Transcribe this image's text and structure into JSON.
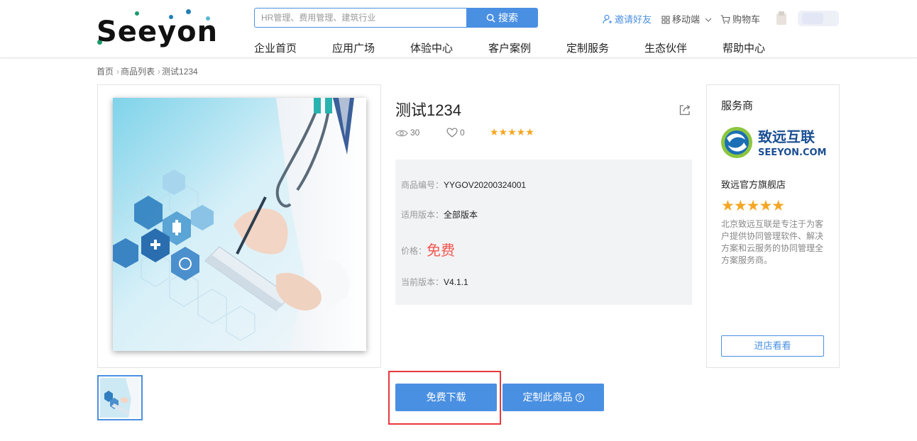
{
  "header": {
    "logo_text": "Seeyon",
    "search_placeholder": "HR管理、费用管理、建筑行业",
    "search_button": "搜索",
    "invite_label": "邀请好友",
    "mobile_label": "移动端",
    "cart_label": "购物车",
    "nav": [
      "企业首页",
      "应用广场",
      "体验中心",
      "客户案例",
      "定制服务",
      "生态伙伴",
      "帮助中心"
    ]
  },
  "breadcrumb": [
    "首页",
    "商品列表",
    "测试1234"
  ],
  "product": {
    "title": "测试1234",
    "views": "30",
    "likes": "0",
    "rating": 5,
    "stars": "★★★★★",
    "code_label": "商品编号：",
    "code_value": "YYGOV20200324001",
    "edition_label": "适用版本：",
    "edition_value": "全部版本",
    "price_label": "价格：",
    "price_value": "免费",
    "version_label": "当前版本：",
    "version_value": "V4.1.1",
    "download_button": "免费下载",
    "custom_button": "定制此商品",
    "custom_help_icon": "?"
  },
  "vendor": {
    "heading": "服务商",
    "logo_cn": "致远互联",
    "logo_en": "SEEYON.COM",
    "name": "致远官方旗舰店",
    "rating": 5,
    "stars": "★★★★★",
    "description": "北京致远互联是专注于为客户提供协同管理软件、解决方案和云服务的协同管理全方案服务商。",
    "visit_button": "进店看看"
  },
  "colors": {
    "accent": "#4a90e2",
    "price": "#f2574f",
    "star": "#f5a623",
    "highlight": "#e8383d"
  }
}
